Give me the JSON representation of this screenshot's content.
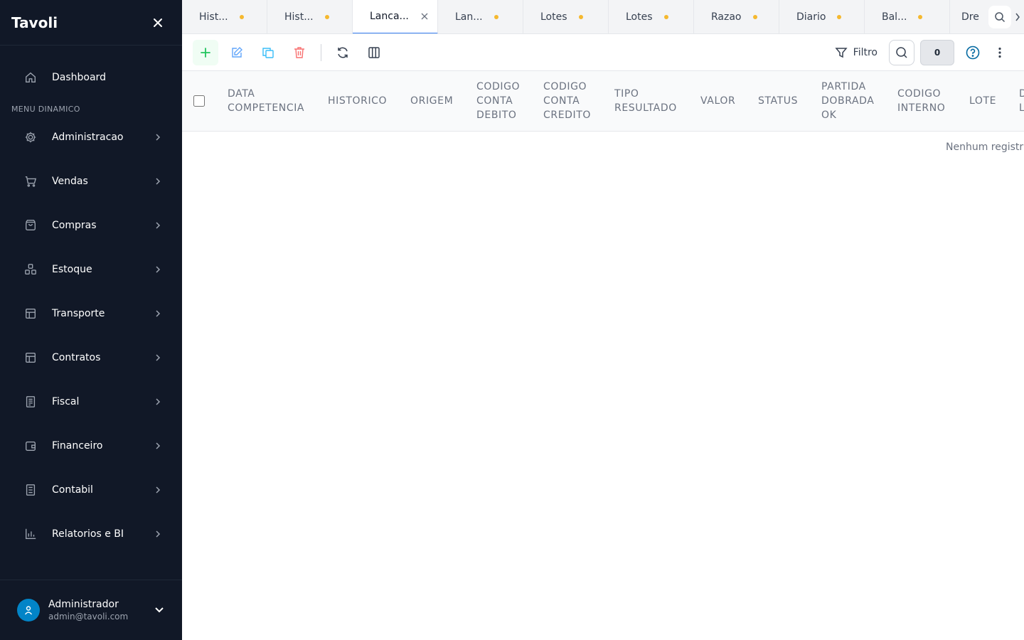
{
  "app": {
    "brand": "Tavoli"
  },
  "sidebar": {
    "dashboard_label": "Dashboard",
    "section_title": "MENU DINAMICO",
    "items": [
      {
        "label": "Administracao",
        "icon": "gear-icon"
      },
      {
        "label": "Vendas",
        "icon": "cart-icon"
      },
      {
        "label": "Compras",
        "icon": "bag-icon"
      },
      {
        "label": "Estoque",
        "icon": "boxes-icon"
      },
      {
        "label": "Transporte",
        "icon": "layout-icon"
      },
      {
        "label": "Contratos",
        "icon": "layout-icon"
      },
      {
        "label": "Fiscal",
        "icon": "receipt-icon"
      },
      {
        "label": "Financeiro",
        "icon": "wallet-icon"
      },
      {
        "label": "Contabil",
        "icon": "book-icon"
      },
      {
        "label": "Relatorios e BI",
        "icon": "bar-chart-icon"
      }
    ],
    "user": {
      "name": "Administrador",
      "email": "admin@tavoli.com"
    }
  },
  "tabs": [
    {
      "label": "Hist...",
      "state": "modified"
    },
    {
      "label": "Hist...",
      "state": "modified"
    },
    {
      "label": "Lanca...",
      "state": "active"
    },
    {
      "label": "Lan...",
      "state": "modified"
    },
    {
      "label": "Lotes",
      "state": "modified"
    },
    {
      "label": "Lotes",
      "state": "modified"
    },
    {
      "label": "Razao",
      "state": "modified"
    },
    {
      "label": "Diario",
      "state": "modified"
    },
    {
      "label": "Bal...",
      "state": "modified"
    },
    {
      "label": "Dre",
      "state": "modified"
    }
  ],
  "toolbar": {
    "filter_label": "Filtro",
    "count": "0"
  },
  "table": {
    "columns": [
      "DATA COMPETENCIA",
      "HISTORICO",
      "ORIGEM",
      "CODIGO CONTA DEBITO",
      "CODIGO CONTA CREDITO",
      "TIPO RESULTADO",
      "VALOR",
      "STATUS",
      "PARTIDA DOBRADA OK",
      "CODIGO INTERNO",
      "LOTE",
      "D L"
    ],
    "empty_message": "Nenhum registr"
  },
  "colors": {
    "sidebar_bg": "#111827",
    "accent": "#3b82f6",
    "add": "#22c55e",
    "edit": "#60a5fa",
    "copy": "#38bdf8",
    "delete": "#f87171",
    "modified_dot": "#f5b82e",
    "help": "#0369a1"
  }
}
